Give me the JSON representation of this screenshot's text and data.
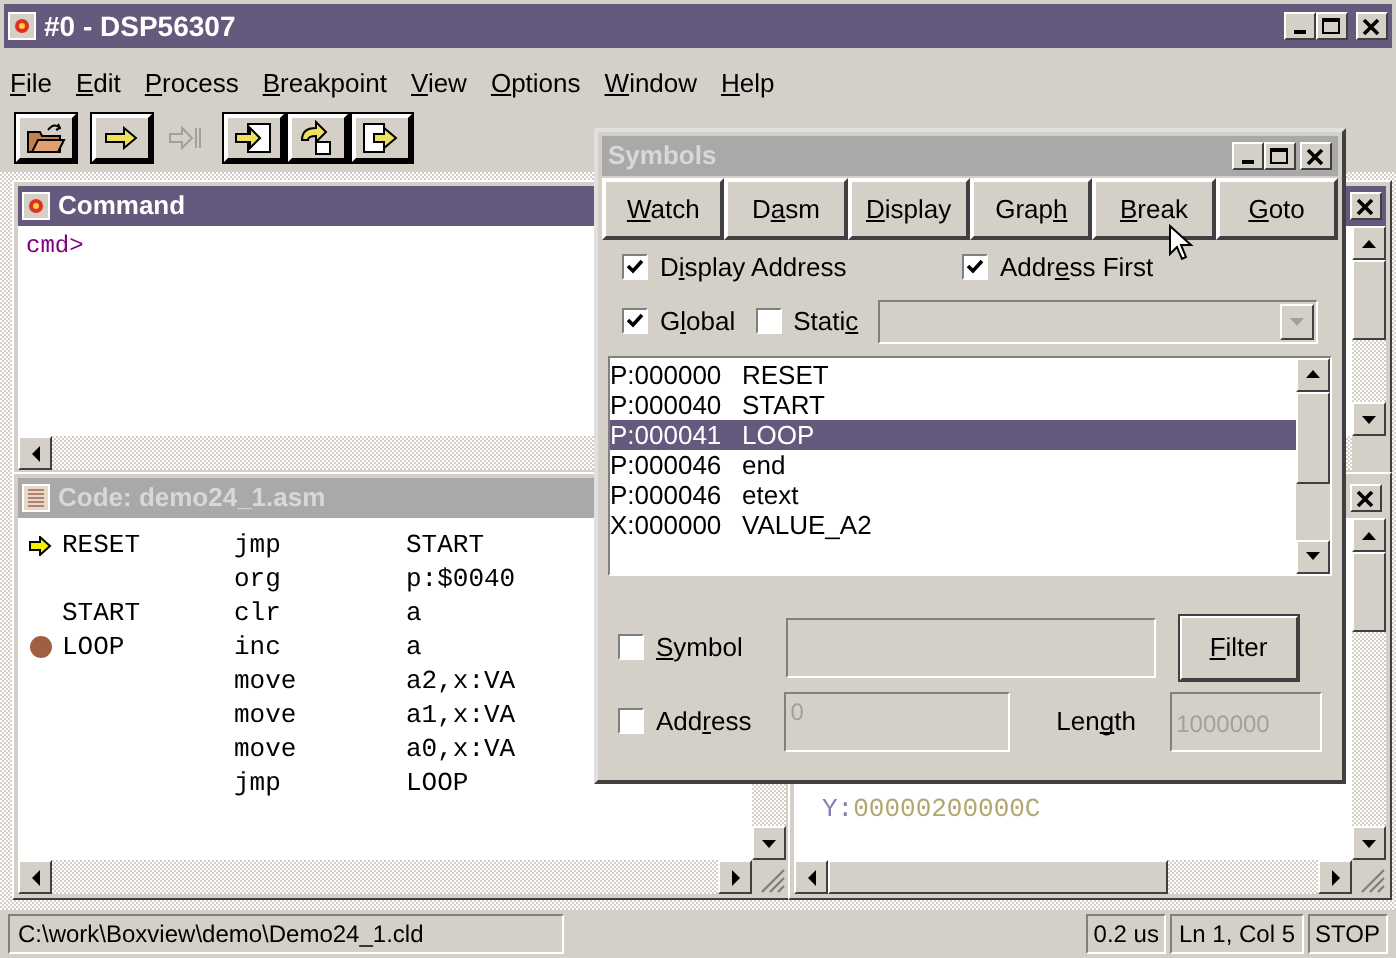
{
  "window": {
    "title": "#0 - DSP56307"
  },
  "menu": [
    {
      "label": [
        {
          "text": "F",
          "underline": true
        },
        {
          "text": "ile",
          "underline": false
        }
      ]
    },
    {
      "label": [
        {
          "text": "E",
          "underline": true
        },
        {
          "text": "dit",
          "underline": false
        }
      ]
    },
    {
      "label": [
        {
          "text": "P",
          "underline": true
        },
        {
          "text": "rocess",
          "underline": false
        }
      ]
    },
    {
      "label": [
        {
          "text": "B",
          "underline": true
        },
        {
          "text": "reakpoint",
          "underline": false
        }
      ]
    },
    {
      "label": [
        {
          "text": "V",
          "underline": true
        },
        {
          "text": "iew",
          "underline": false
        }
      ]
    },
    {
      "label": [
        {
          "text": "O",
          "underline": true
        },
        {
          "text": "ptions",
          "underline": false
        }
      ]
    },
    {
      "label": [
        {
          "text": "W",
          "underline": true
        },
        {
          "text": "indow",
          "underline": false
        }
      ]
    },
    {
      "label": [
        {
          "text": "H",
          "underline": true
        },
        {
          "text": "elp",
          "underline": false
        }
      ]
    }
  ],
  "toolbar": [
    {
      "kind": "open",
      "disabled": false
    },
    {
      "kind": "run",
      "disabled": false
    },
    {
      "kind": "step",
      "disabled": true
    },
    {
      "kind": "into",
      "disabled": false
    },
    {
      "kind": "return",
      "disabled": false
    },
    {
      "kind": "over",
      "disabled": false
    }
  ],
  "command_window": {
    "title": "Command",
    "active": true,
    "prompt": "cmd>"
  },
  "code_window": {
    "title": "Code: demo24_1.asm",
    "active": false,
    "rows": [
      {
        "kind": "arrow",
        "label": "RESET",
        "op": "jmp",
        "arg": "START"
      },
      {
        "kind": "plain",
        "op": "org",
        "arg": "p:$0040"
      },
      {
        "kind": "plain",
        "label": "START",
        "op": "clr",
        "arg": "a"
      },
      {
        "kind": "breakpoint",
        "label": "LOOP",
        "op": "inc",
        "arg": "a"
      },
      {
        "kind": "plain",
        "op": "move",
        "arg": "a2,x:VA"
      },
      {
        "kind": "plain",
        "op": "move",
        "arg": "a1,x:VA"
      },
      {
        "kind": "plain",
        "op": "move",
        "arg": "a0,x:VA"
      },
      {
        "kind": "plain",
        "op": "jmp",
        "arg": "LOOP"
      }
    ]
  },
  "memory_window": {
    "space": "Y:",
    "value": "00000200000C"
  },
  "symbols_dialog": {
    "title": "Symbols",
    "buttons": [
      {
        "label": [
          {
            "text": "W",
            "underline": true
          },
          {
            "text": "atch",
            "underline": false
          }
        ]
      },
      {
        "label": [
          {
            "text": "D",
            "underline": false
          },
          {
            "text": "a",
            "underline": true
          },
          {
            "text": "sm",
            "underline": false
          }
        ]
      },
      {
        "label": [
          {
            "text": "D",
            "underline": true
          },
          {
            "text": "isplay",
            "underline": false
          }
        ]
      },
      {
        "label": [
          {
            "text": "Grap",
            "underline": false
          },
          {
            "text": "h",
            "underline": true
          }
        ]
      },
      {
        "label": [
          {
            "text": "B",
            "underline": true
          },
          {
            "text": "reak",
            "underline": false
          }
        ]
      },
      {
        "label": [
          {
            "text": "G",
            "underline": true
          },
          {
            "text": "oto",
            "underline": false
          }
        ]
      }
    ],
    "options": [
      {
        "label": [
          {
            "text": "D",
            "underline": false
          },
          {
            "text": "i",
            "underline": true
          },
          {
            "text": "splay Address",
            "underline": false
          }
        ],
        "checked": true
      },
      {
        "label": [
          {
            "text": "Addr",
            "underline": false
          },
          {
            "text": "e",
            "underline": true
          },
          {
            "text": "ss First",
            "underline": false
          }
        ],
        "checked": true
      },
      {
        "label": [
          {
            "text": "G",
            "underline": false
          },
          {
            "text": "l",
            "underline": true
          },
          {
            "text": "obal",
            "underline": false
          }
        ],
        "checked": true
      },
      {
        "label": [
          {
            "text": "Stati",
            "underline": false
          },
          {
            "text": "c",
            "underline": true
          }
        ],
        "checked": false
      }
    ],
    "symbols": [
      {
        "address": "P:000000",
        "name": "RESET",
        "selected": false
      },
      {
        "address": "P:000040",
        "name": "START",
        "selected": false
      },
      {
        "address": "P:000041",
        "name": "LOOP",
        "selected": true
      },
      {
        "address": "P:000046",
        "name": "end",
        "selected": false
      },
      {
        "address": "P:000046",
        "name": "etext",
        "selected": false
      },
      {
        "address": "X:000000",
        "name": "VALUE_A2",
        "selected": false
      }
    ],
    "symbol_filter": {
      "label": [
        {
          "text": "S",
          "underline": true
        },
        {
          "text": "ymbol",
          "underline": false
        }
      ],
      "checked": false
    },
    "filter_button": {
      "label": [
        {
          "text": "F",
          "underline": true
        },
        {
          "text": "ilter",
          "underline": false
        }
      ]
    },
    "address_filter": {
      "label": [
        {
          "text": "Add",
          "underline": false
        },
        {
          "text": "r",
          "underline": true
        },
        {
          "text": "ess",
          "underline": false
        }
      ],
      "checked": false,
      "value": "0"
    },
    "length": {
      "label": [
        {
          "text": "Len",
          "underline": false
        },
        {
          "text": "g",
          "underline": true
        },
        {
          "text": "th",
          "underline": false
        }
      ],
      "value": "1000000"
    }
  },
  "status_bar": {
    "path": "C:\\work\\Boxview\\demo\\Demo24_1.cld",
    "time": "0.2 us",
    "position": "Ln 1, Col 5",
    "state": "STOP"
  }
}
